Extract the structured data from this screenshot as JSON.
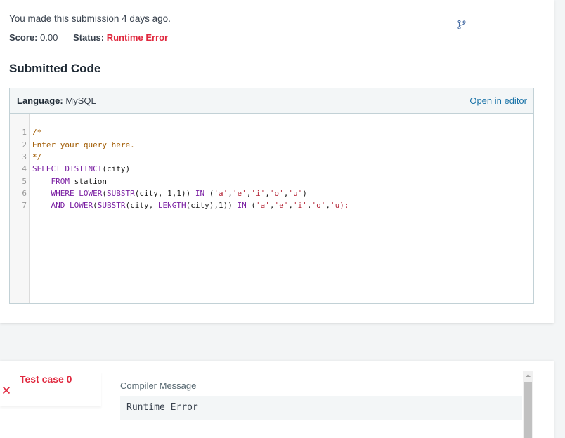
{
  "submission": {
    "ago_text": "You made this submission 4 days ago.",
    "score_label": "Score:",
    "score_value": "0.00",
    "status_label": "Status:",
    "status_value": "Runtime Error"
  },
  "section_title": "Submitted Code",
  "editor": {
    "language_label": "Language:",
    "language_value": "MySQL",
    "open_in_editor": "Open in editor",
    "line_numbers": [
      "1",
      "2",
      "3",
      "4",
      "5",
      "6",
      "7"
    ]
  },
  "test_case": {
    "label": "Test case 0",
    "compiler_message_label": "Compiler Message",
    "compiler_message": "Runtime Error"
  },
  "icons": {
    "branch": "branch-icon",
    "test_failed": "close-icon"
  },
  "colors": {
    "error_red": "#e0283e",
    "link_blue": "#1a73a8"
  }
}
